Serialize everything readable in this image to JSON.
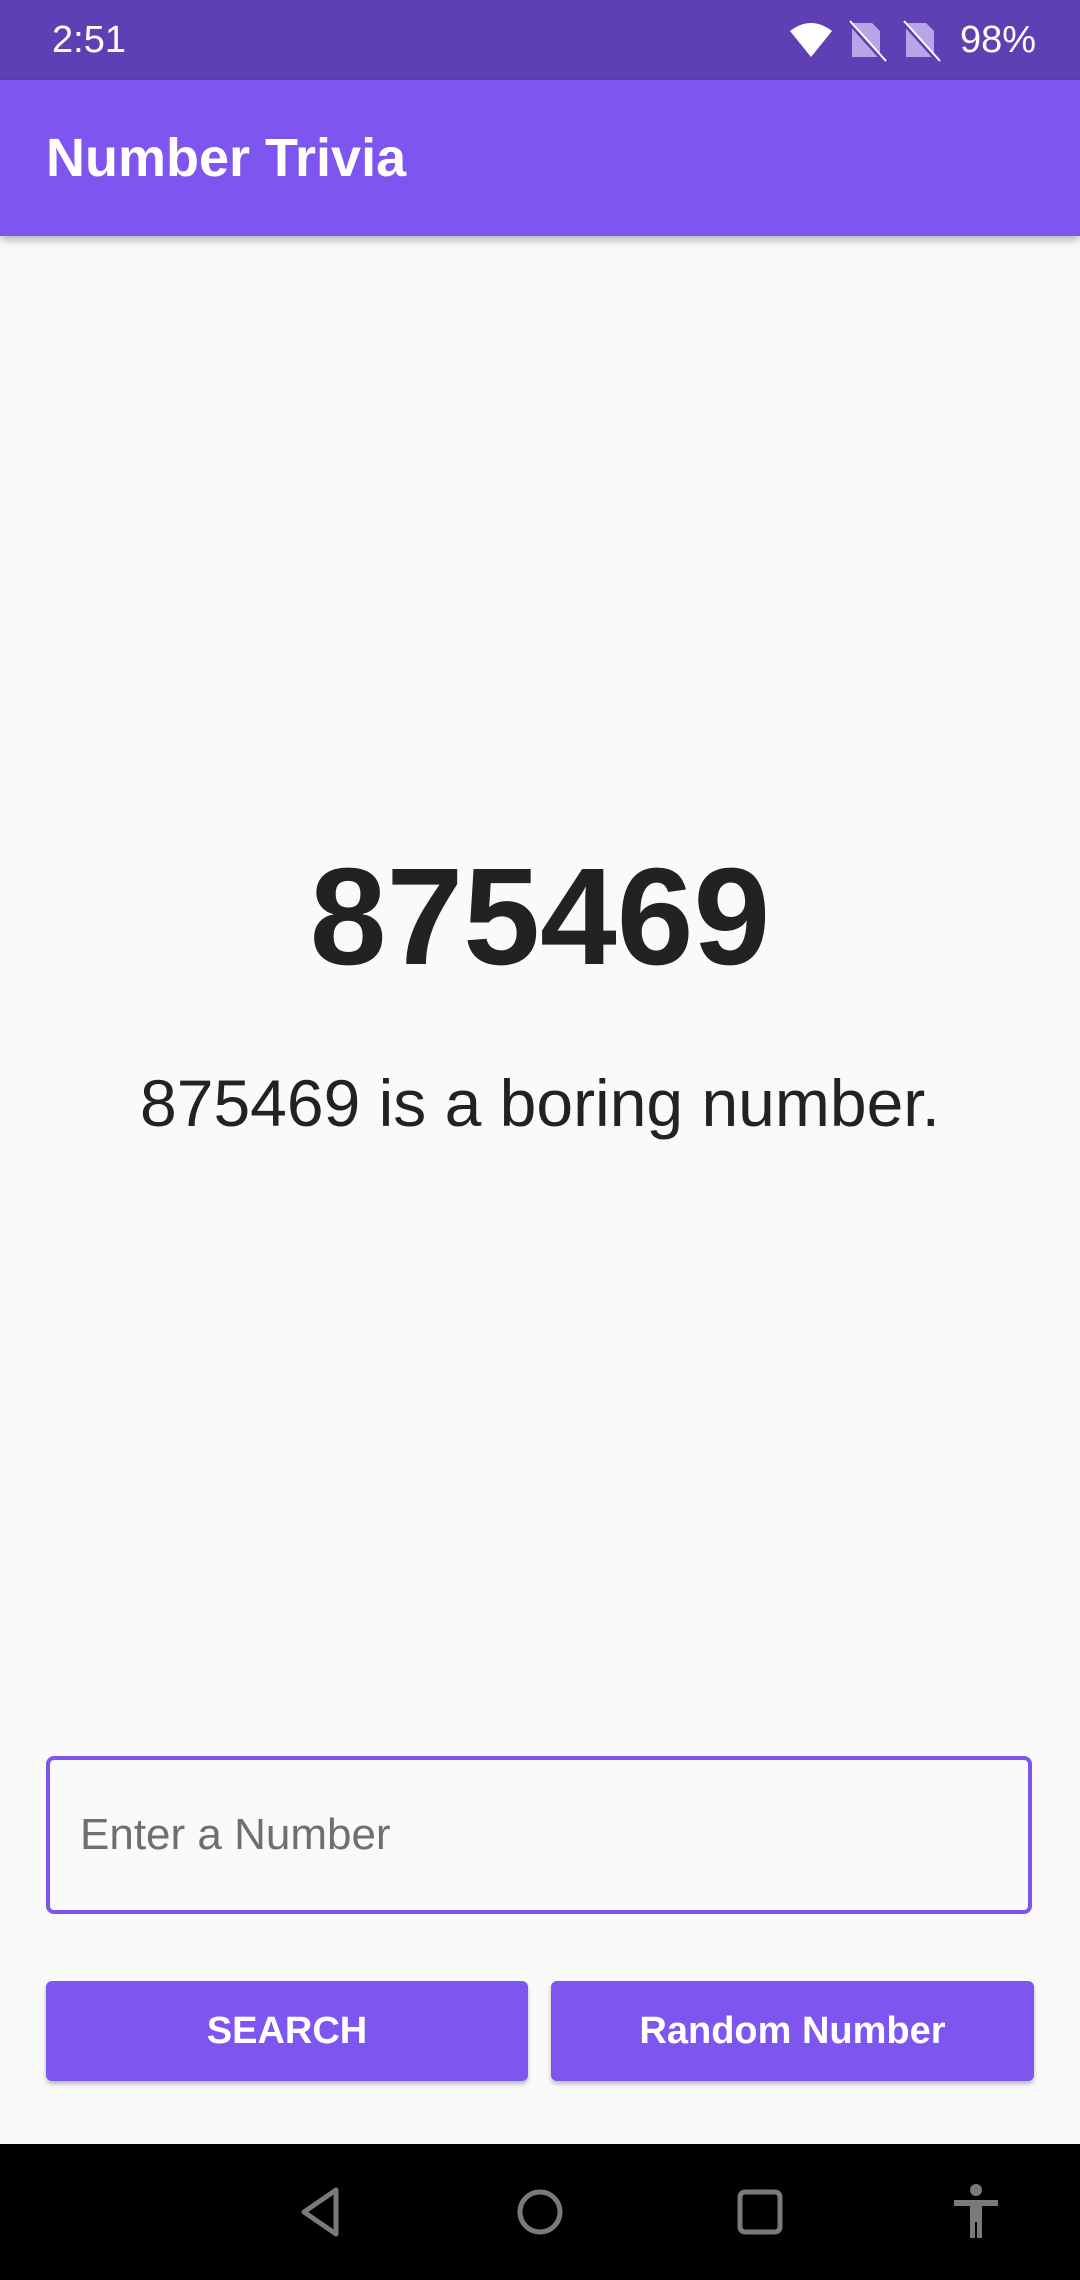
{
  "status_bar": {
    "time": "2:51",
    "battery": "98%",
    "icons": [
      "wifi-icon",
      "sim-off-icon",
      "sim-off-icon"
    ]
  },
  "app_bar": {
    "title": "Number Trivia"
  },
  "trivia": {
    "number": "875469",
    "text": "875469 is a boring number."
  },
  "input": {
    "placeholder": "Enter a Number",
    "value": ""
  },
  "buttons": {
    "search_label": "SEARCH",
    "random_label": "Random Number"
  },
  "nav_bar": {
    "icons": [
      "back-icon",
      "home-icon",
      "recents-icon",
      "accessibility-icon"
    ]
  },
  "colors": {
    "status_bar": "#5f3fb4",
    "primary": "#7e55ee",
    "background": "#fafafa",
    "text": "#222222"
  }
}
